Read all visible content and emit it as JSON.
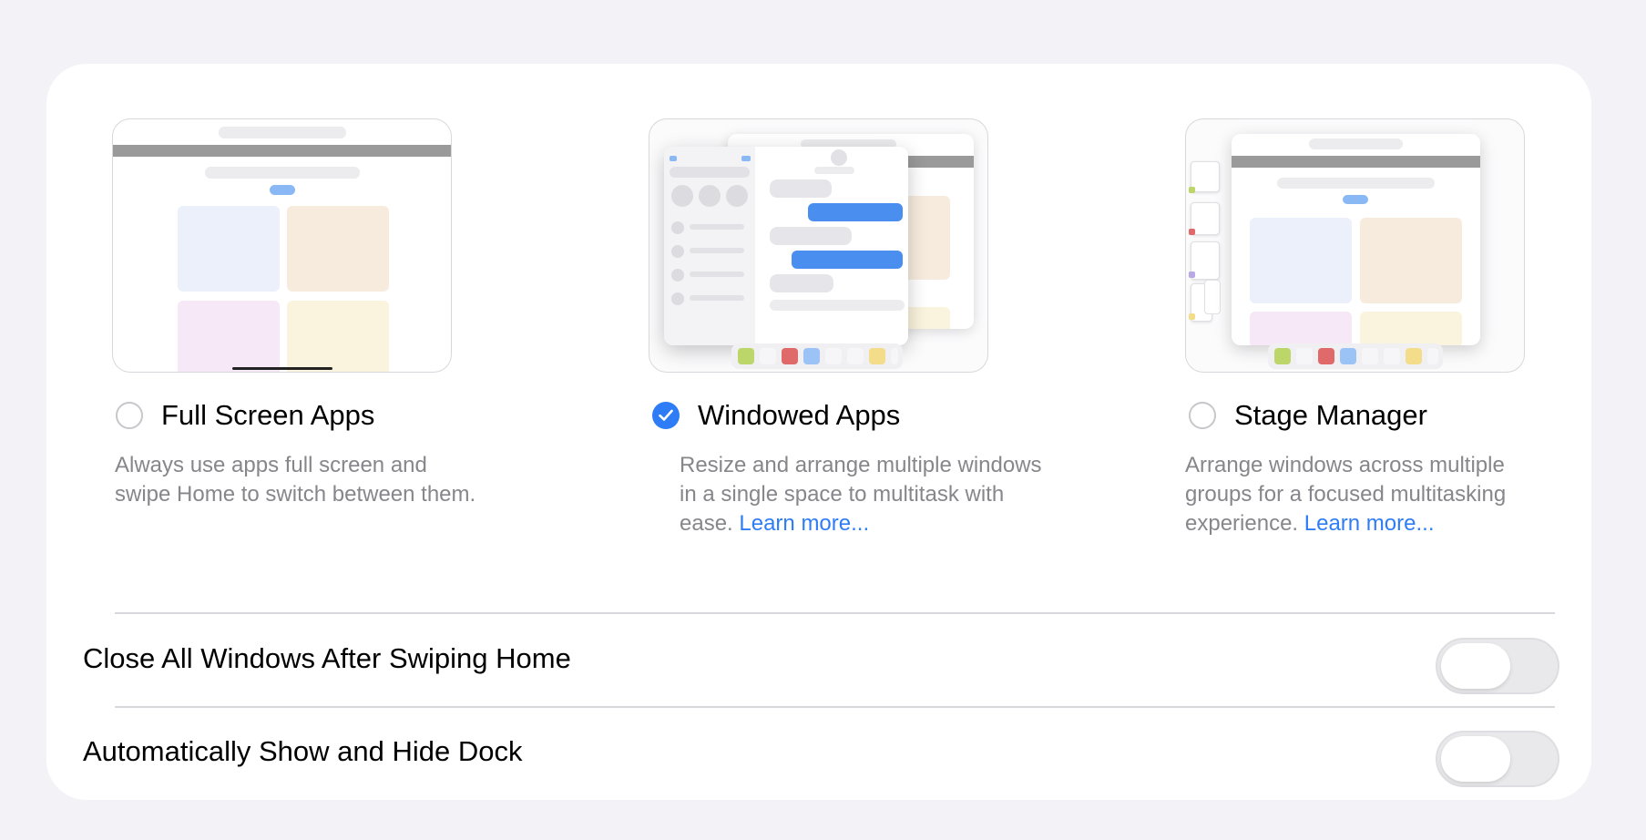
{
  "options": [
    {
      "label": "Full Screen Apps",
      "description": "Always use apps full screen and swipe Home to switch between them.",
      "selected": false
    },
    {
      "label": "Windowed Apps",
      "description": "Resize and arrange multiple windows in a single space to multitask with ease.",
      "link": "Learn more...",
      "selected": true
    },
    {
      "label": "Stage Manager",
      "description": "Arrange windows across multiple groups for a focused multitasking experience.",
      "link": "Learn more...",
      "selected": false
    }
  ],
  "settings": [
    {
      "label": "Close All Windows After Swiping Home",
      "enabled": false
    },
    {
      "label": "Automatically Show and Hide Dock",
      "enabled": false
    }
  ],
  "colors": {
    "accent": "#2f7df6",
    "background": "#f2f2f7",
    "card": "#ffffff",
    "secondary_text": "#86868b"
  }
}
